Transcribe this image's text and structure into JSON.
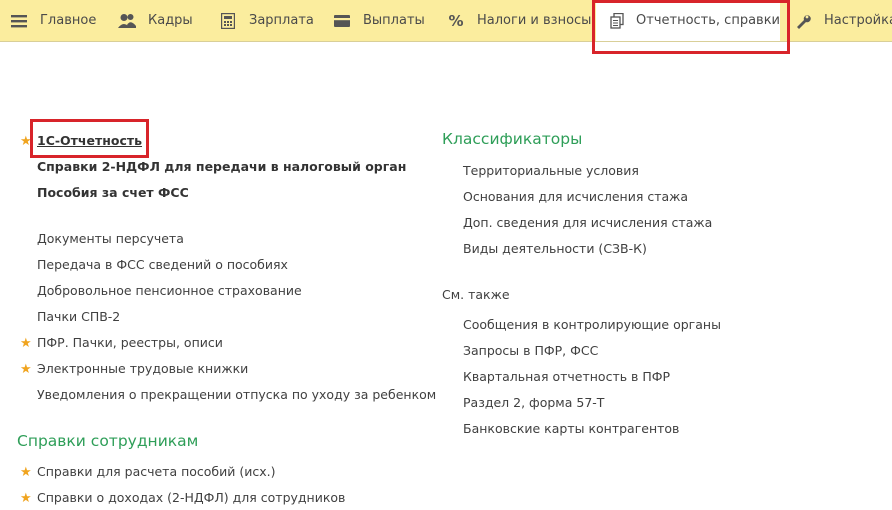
{
  "tabs": [
    {
      "label": "Главное",
      "icon": "menu-icon"
    },
    {
      "label": "Кадры",
      "icon": "people-icon"
    },
    {
      "label": "Зарплата",
      "icon": "calculator-icon"
    },
    {
      "label": "Выплаты",
      "icon": "card-icon"
    },
    {
      "label": "Налоги и взносы",
      "icon": "percent-icon"
    },
    {
      "label": "Отчетность, справки",
      "icon": "documents-icon",
      "active": true
    },
    {
      "label": "Настройка",
      "icon": "wrench-icon"
    }
  ],
  "left": {
    "top_links": [
      {
        "label": "1С-Отчетность",
        "starred": true
      },
      {
        "label": "Справки 2-НДФЛ для передачи в налоговый орган"
      },
      {
        "label": "Пособия за счет ФСС"
      }
    ],
    "links": [
      {
        "label": "Документы персучета"
      },
      {
        "label": "Передача в ФСС сведений о пособиях"
      },
      {
        "label": "Добровольное пенсионное страхование"
      },
      {
        "label": "Пачки СПВ-2"
      },
      {
        "label": "ПФР. Пачки, реестры, описи",
        "starred": true
      },
      {
        "label": "Электронные трудовые книжки",
        "starred": true
      },
      {
        "label": "Уведомления о прекращении отпуска по уходу за ребенком"
      }
    ],
    "section_title": "Справки сотрудникам",
    "section_links": [
      {
        "label": "Справки для расчета пособий (исх.)",
        "starred": true
      },
      {
        "label": "Справки о доходах (2-НДФЛ) для сотрудников",
        "starred": true
      }
    ]
  },
  "right": {
    "section_title": "Классификаторы",
    "links": [
      {
        "label": "Территориальные условия"
      },
      {
        "label": "Основания для исчисления стажа"
      },
      {
        "label": "Доп. сведения для исчисления стажа"
      },
      {
        "label": "Виды деятельности (СЗВ-К)"
      }
    ],
    "see_also_title": "См. также",
    "see_also": [
      {
        "label": "Сообщения в контролирующие органы"
      },
      {
        "label": "Запросы в ПФР, ФСС"
      },
      {
        "label": "Квартальная отчетность в ПФР"
      },
      {
        "label": "Раздел 2, форма 57-Т"
      },
      {
        "label": "Банковские карты контрагентов"
      }
    ]
  },
  "colors": {
    "tabbar": "#fbed9e",
    "section": "#2e9e58",
    "highlight": "#d8242a",
    "star": "#f0a41f"
  }
}
